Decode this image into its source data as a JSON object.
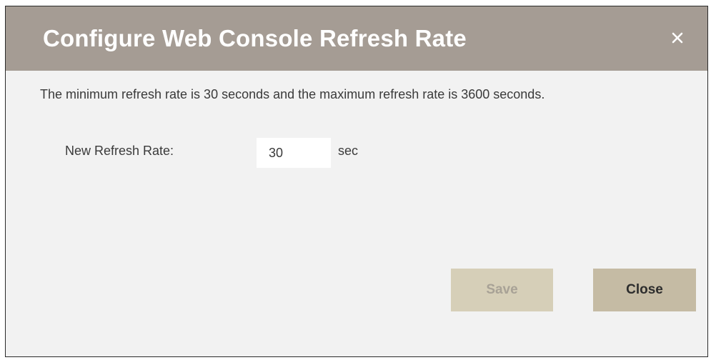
{
  "dialog": {
    "title": "Configure Web Console Refresh Rate",
    "close_icon": "close-icon",
    "description": "The minimum refresh rate is 30 seconds and the maximum refresh rate is 3600 seconds.",
    "field": {
      "label": "New Refresh Rate:",
      "value": "30",
      "unit": "sec"
    },
    "buttons": {
      "save_label": "Save",
      "save_enabled": false,
      "close_label": "Close"
    }
  },
  "colors": {
    "titlebar": "#a59c94",
    "dialog_background": "#f2f2f2",
    "save_button": "#d6cfb8",
    "close_button": "#c5bba4",
    "text": "#3a3a3a"
  }
}
